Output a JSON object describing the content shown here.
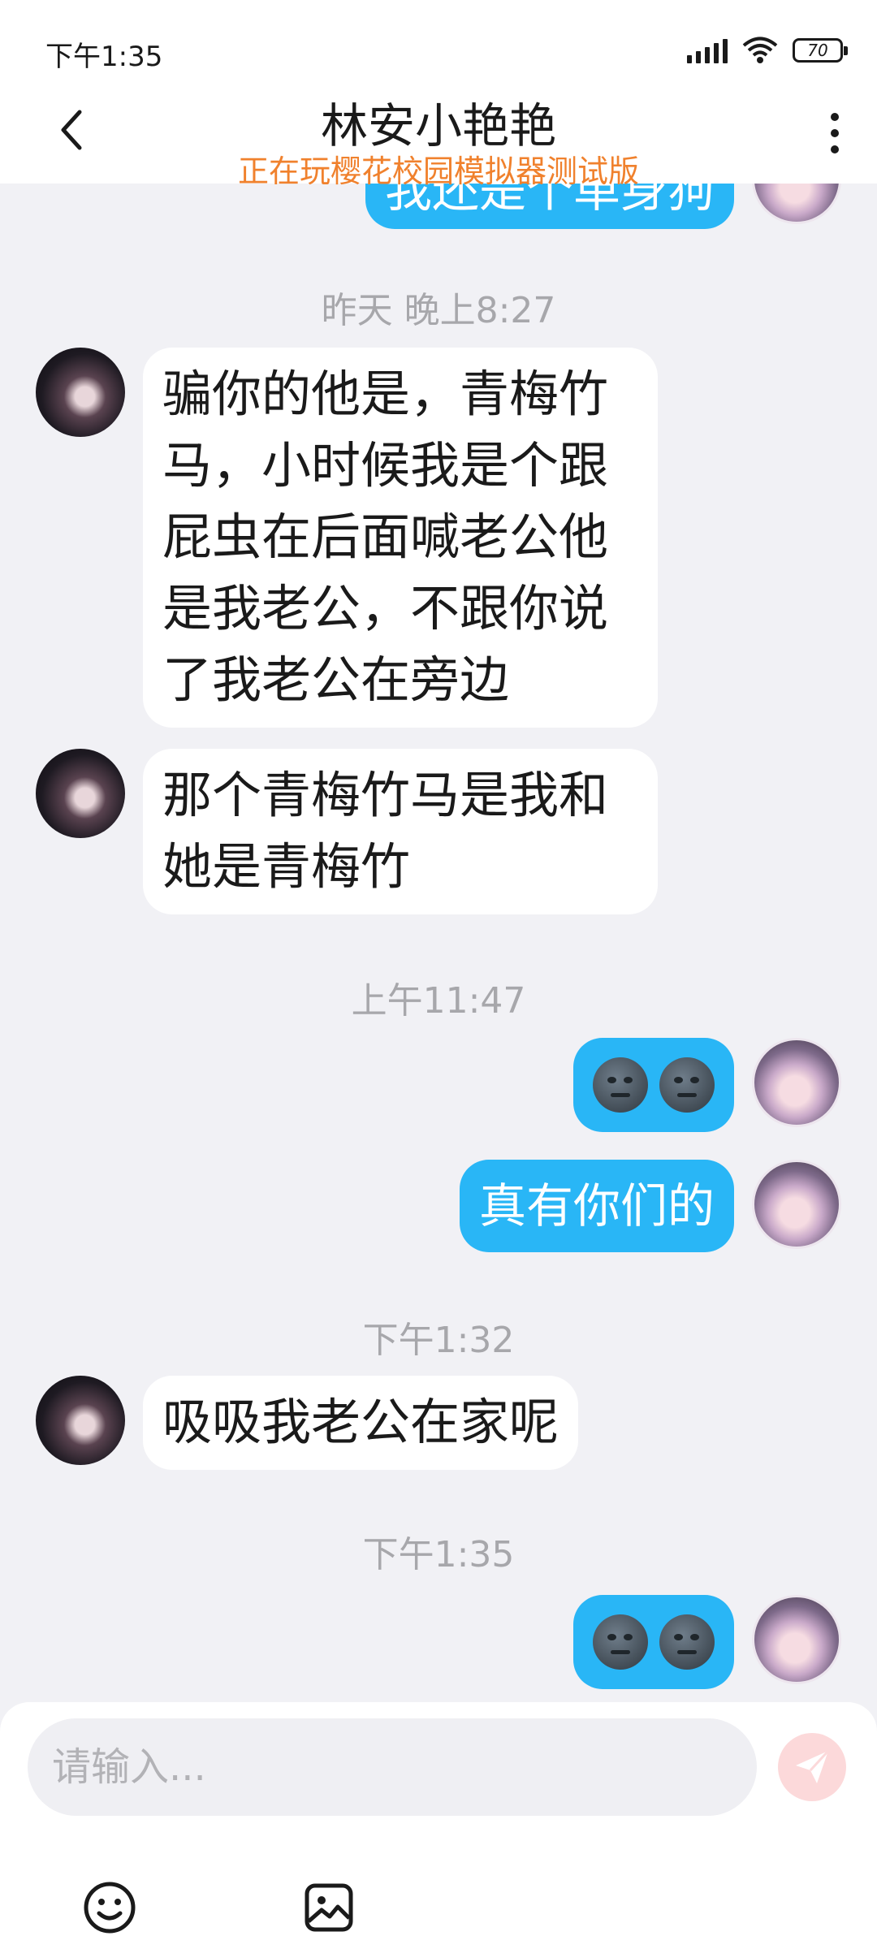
{
  "status_bar": {
    "time": "下午1:35",
    "battery": "70"
  },
  "header": {
    "title": "林安小艳艳",
    "subtitle": "正在玩樱花校园模拟器测试版"
  },
  "messages": {
    "top_partial_text": "我还是个单身狗",
    "ts1": "昨天 晚上8:27",
    "m1": "骗你的他是，青梅竹马，小时候我是个跟屁虫在后面喊老公他是我老公，不跟你说了我老公在旁边",
    "m2": "那个青梅竹马是我和她是青梅竹",
    "ts2": "上午11:47",
    "m3_emoji": "moon-face-emoji x2",
    "m4": "真有你们的",
    "ts3": "下午1:32",
    "m5": "吸吸我老公在家呢",
    "ts4": "下午1:35",
    "m6_emoji": "moon-face-emoji x2"
  },
  "input": {
    "placeholder": "请输入..."
  },
  "icons": {
    "back": "chevron-left-icon",
    "more": "more-vertical-icon",
    "send": "send-icon",
    "emoji": "smiley-icon",
    "image": "image-icon"
  },
  "colors": {
    "bubble_outgoing": "#29B6F6",
    "bubble_incoming": "#FFFFFF",
    "subtitle": "#F0812D",
    "background": "#F1F1F5",
    "send_button": "#FCD9DA"
  }
}
